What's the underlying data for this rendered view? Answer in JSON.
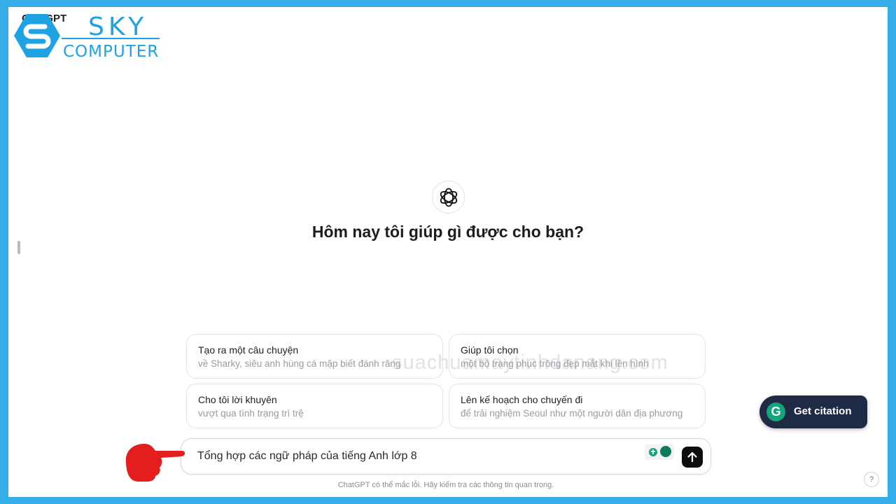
{
  "app": {
    "title": "ChatGPT"
  },
  "logo": {
    "line1": "SKY",
    "line2": "COMPUTER"
  },
  "main": {
    "heading": "Hôm nay tôi giúp gì được cho bạn?"
  },
  "suggestions": [
    {
      "title": "Tạo ra một câu chuyện",
      "subtitle": "về Sharky, siêu anh hùng cá mập biết đánh răng"
    },
    {
      "title": "Giúp tôi chọn",
      "subtitle": "một bộ trang phục trông đẹp mắt khi lên hình"
    },
    {
      "title": "Cho tôi lời khuyên",
      "subtitle": "vượt qua tình trạng trì trệ"
    },
    {
      "title": "Lên kế hoạch cho chuyến đi",
      "subtitle": "để trải nghiệm Seoul như một người dân địa phương"
    }
  ],
  "watermark": "suachuamaytinhdanang.com",
  "composer": {
    "value": "Tổng hợp các ngữ pháp của tiếng Anh lớp 8"
  },
  "footer": {
    "note": "ChatGPT có thể mắc lỗi. Hãy kiểm tra các thông tin quan trọng."
  },
  "citation": {
    "icon_letter": "G",
    "label": "Get citation"
  },
  "help": {
    "label": "?"
  },
  "colors": {
    "frame": "#35aee8",
    "logo": "#1fa2e4",
    "citation_bg": "#1f2a44",
    "grammarly": "#13a57a",
    "pointer": "#e41e1e"
  }
}
